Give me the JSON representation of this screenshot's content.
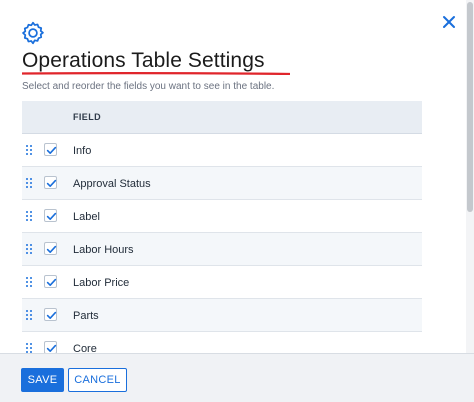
{
  "header": {
    "title": "Operations Table Settings",
    "subtitle": "Select and reorder the fields you want to see in the table.",
    "icon": "gear-icon",
    "close_icon": "close-icon"
  },
  "table": {
    "column_header": "FIELD",
    "rows": [
      {
        "label": "Info",
        "checked": true
      },
      {
        "label": "Approval Status",
        "checked": true
      },
      {
        "label": "Label",
        "checked": true
      },
      {
        "label": "Labor Hours",
        "checked": true
      },
      {
        "label": "Labor Price",
        "checked": true
      },
      {
        "label": "Parts",
        "checked": true
      },
      {
        "label": "Core",
        "checked": true
      }
    ]
  },
  "footer": {
    "save_label": "SAVE",
    "cancel_label": "CANCEL"
  },
  "colors": {
    "accent": "#1a6fdc",
    "underline": "#e0252b"
  }
}
